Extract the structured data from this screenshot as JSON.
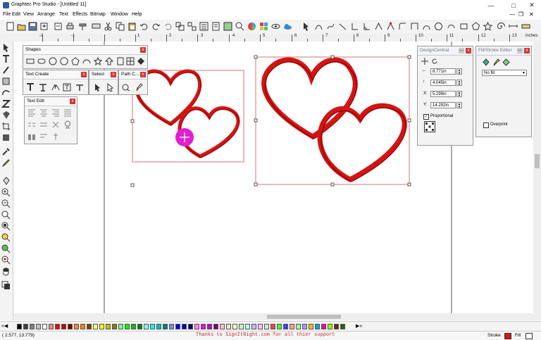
{
  "window": {
    "title": "Graphtec Pro Studio - [Untitled 11]"
  },
  "menu": [
    "File",
    "Edit",
    "View",
    "Arrange",
    "Text",
    "Effects",
    "Bitmap",
    "Window",
    "Help"
  ],
  "ruler": {
    "unit_label": "inches",
    "numbers": [
      "-2",
      "-1",
      "1",
      "2",
      "3",
      "4",
      "5",
      "6",
      "7",
      "8",
      "9",
      "10",
      "11",
      "12",
      "13"
    ]
  },
  "panels": {
    "shapes": {
      "title": "Shapes"
    },
    "text_create": {
      "title": "Text Create"
    },
    "select": {
      "title": "Select"
    },
    "path": {
      "title": "Path C..."
    },
    "text_edit": {
      "title": "Text Edit"
    },
    "design_central": {
      "title": "DesignCentral",
      "width": "8.771in",
      "height": "4.045in",
      "x": "5.299in",
      "y": "14.292in",
      "proportional_label": "Proportional",
      "proportional_checked": true
    },
    "fill_stroke": {
      "title": "Fill/Stroke Editor",
      "fill_value": "No fill",
      "overprint_label": "Overprint",
      "overprint_checked": false
    }
  },
  "status": {
    "coords": "( 2.577,   13.779)",
    "message": "Thanks to SignItRight.com for all thier support",
    "stroke_label": "Stroke",
    "fill_label": "Fill"
  },
  "colors": {
    "heart_red": "#d41414",
    "heart_dark": "#8a0000",
    "cursor_magenta": "#e020d0",
    "selection_box": "#d05050",
    "status_text": "#c03030",
    "palette": [
      "#000000",
      "#404040",
      "#808080",
      "#c0c0c0",
      "#ffffff",
      "#ff8080",
      "#ff0000",
      "#c00000",
      "#800000",
      "#ff8040",
      "#ff8000",
      "#804000",
      "#ffff80",
      "#ffff00",
      "#c0c000",
      "#808000",
      "#80ff80",
      "#00ff00",
      "#00c000",
      "#008000",
      "#80ffff",
      "#00ffff",
      "#00c0c0",
      "#008080",
      "#8080ff",
      "#0000ff",
      "#0000c0",
      "#000080",
      "#ff80ff",
      "#ff00ff",
      "#c000c0",
      "#800080",
      "#ffc0c0",
      "#ffe0c0",
      "#ffffc0",
      "#c0ffc0",
      "#c0ffff",
      "#c0c0ff",
      "#ffc0ff",
      "#e0e0e0",
      "#ff4040",
      "#40ff40",
      "#4040ff",
      "#ffa0a0",
      "#a0ffa0",
      "#a0a0ff",
      "#f0c000",
      "#00a0f0",
      "#f000a0",
      "#a0f000",
      "#603000",
      "#306000"
    ]
  }
}
